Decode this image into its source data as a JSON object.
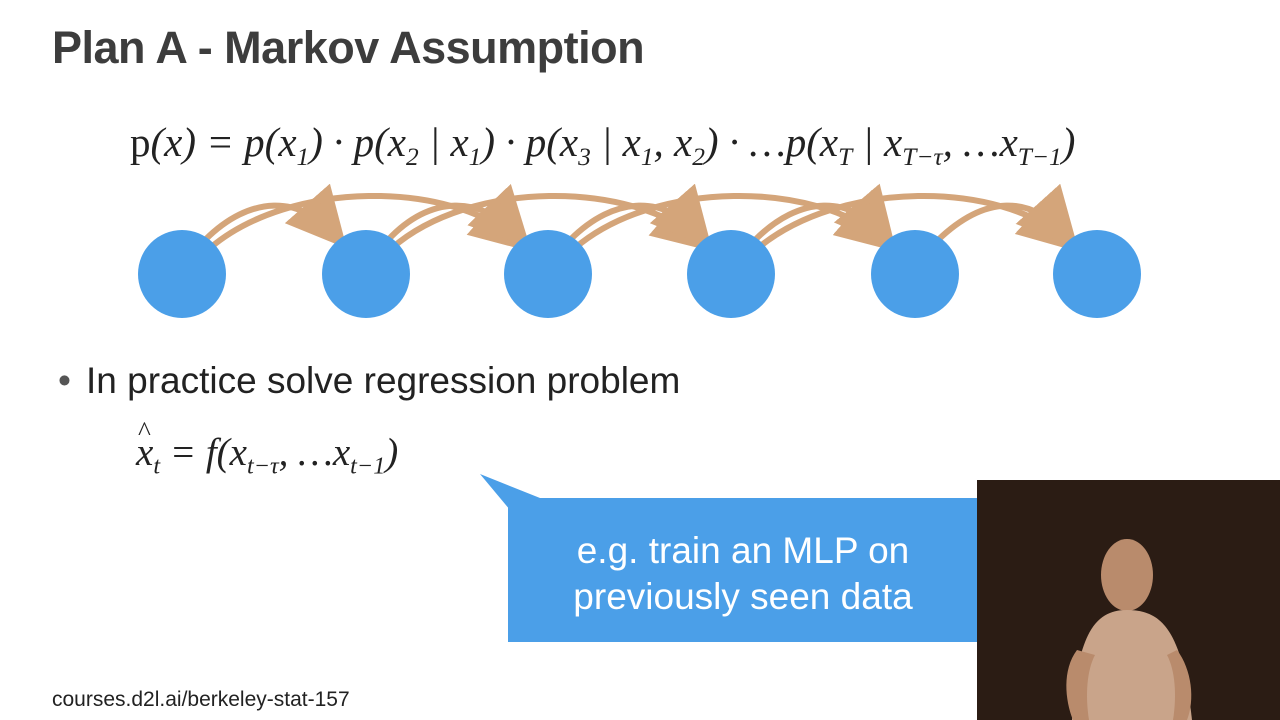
{
  "slide": {
    "title": "Plan A - Markov Assumption",
    "formula": {
      "lhs": "p(x) = ",
      "terms": [
        "p(x1)",
        "p(x2 | x1)",
        "p(x3 | x1, x2)",
        "…p(xT | xT−τ, …xT−1)"
      ]
    },
    "bullet": "In practice solve regression problem",
    "regression": "x̂t = f(xt−τ, …xt−1)",
    "callout": {
      "line1": "e.g. train an MLP on",
      "line2": "previously seen data"
    },
    "footer": "courses.d2l.ai/berkeley-stat-157"
  },
  "colors": {
    "node": "#4b9fe8",
    "arrow": "#d4a57a",
    "title": "#3d3d3d",
    "callout": "#4b9fe8"
  }
}
